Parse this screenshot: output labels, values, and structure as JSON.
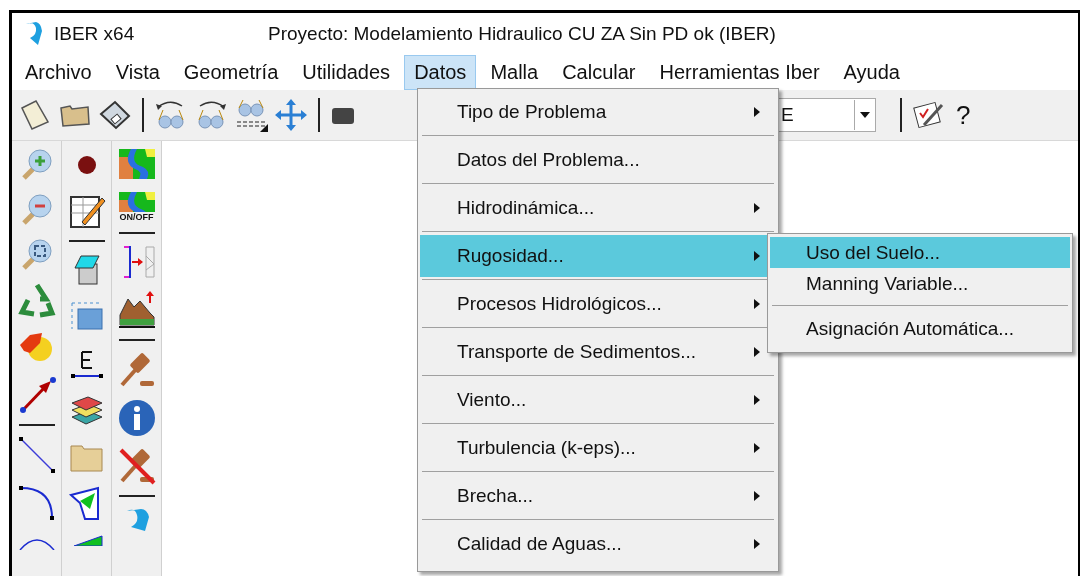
{
  "window": {
    "app_name": "IBER x64",
    "title": "Proyecto: Modelamiento Hidraulico CU ZA Sin PD ok (IBER)"
  },
  "menu_bar": [
    {
      "label": "Archivo",
      "selected": false
    },
    {
      "label": "Vista",
      "selected": false
    },
    {
      "label": "Geometría",
      "selected": false
    },
    {
      "label": "Utilidades",
      "selected": false
    },
    {
      "label": "Datos",
      "selected": true
    },
    {
      "label": "Malla",
      "selected": false
    },
    {
      "label": "Calcular",
      "selected": false
    },
    {
      "label": "Herramientas Iber",
      "selected": false
    },
    {
      "label": "Ayuda",
      "selected": false
    }
  ],
  "toolbar": {
    "combo_value": "E",
    "help_glyph": "?"
  },
  "side_toolbar": {
    "toggle_label": "ON/OFF"
  },
  "dropdown": [
    {
      "label": "Tipo de Problema",
      "submenu": true,
      "selected": false
    },
    {
      "label": "Datos del Problema...",
      "submenu": false,
      "selected": false
    },
    {
      "label": "Hidrodinámica...",
      "submenu": true,
      "selected": false
    },
    {
      "label": "Rugosidad...",
      "submenu": true,
      "selected": true
    },
    {
      "label": "Procesos Hidrológicos...",
      "submenu": true,
      "selected": false
    },
    {
      "label": "Transporte de Sedimentos...",
      "submenu": true,
      "selected": false
    },
    {
      "label": "Viento...",
      "submenu": true,
      "selected": false
    },
    {
      "label": "Turbulencia (k-eps)...",
      "submenu": true,
      "selected": false
    },
    {
      "label": "Brecha...",
      "submenu": true,
      "selected": false
    },
    {
      "label": "Calidad de Aguas...",
      "submenu": true,
      "selected": false
    }
  ],
  "submenu": [
    {
      "label": "Uso del Suelo...",
      "selected": true,
      "separator_before": false
    },
    {
      "label": "Manning Variable...",
      "selected": false,
      "separator_before": false
    },
    {
      "label": "Asignación Automática...",
      "selected": false,
      "separator_before": true
    }
  ]
}
